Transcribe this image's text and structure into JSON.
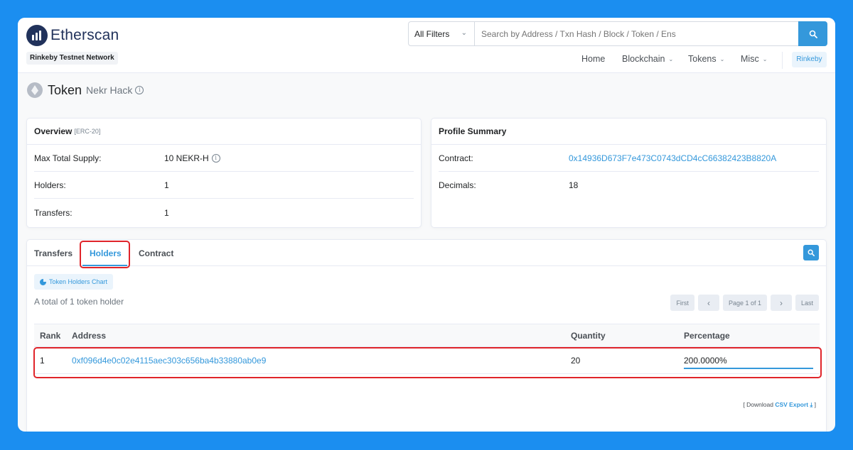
{
  "header": {
    "logo_text": "Etherscan",
    "network_badge": "Rinkeby Testnet Network",
    "search": {
      "filter_value": "All Filters",
      "placeholder": "Search by Address / Txn Hash / Block / Token / Ens"
    },
    "nav": {
      "home": "Home",
      "blockchain": "Blockchain",
      "tokens": "Tokens",
      "misc": "Misc",
      "network_pill": "Rinkeby"
    }
  },
  "title": {
    "main": "Token",
    "sub": "Nekr Hack"
  },
  "overview": {
    "heading": "Overview",
    "tag": "[ERC-20]",
    "rows": [
      {
        "key": "Max Total Supply:",
        "value": "10 NEKR-H"
      },
      {
        "key": "Holders:",
        "value": "1"
      },
      {
        "key": "Transfers:",
        "value": "1"
      }
    ]
  },
  "profile": {
    "heading": "Profile Summary",
    "rows": [
      {
        "key": "Contract:",
        "value": "0x14936D673F7e473C0743dCD4cC66382423B8820A"
      },
      {
        "key": "Decimals:",
        "value": "18"
      }
    ]
  },
  "tabs": [
    {
      "label": "Transfers"
    },
    {
      "label": "Holders"
    },
    {
      "label": "Contract"
    }
  ],
  "holders": {
    "chart_button": "Token Holders Chart",
    "total_text": "A total of 1 token holder",
    "pager": {
      "first": "First",
      "prev": "‹",
      "page": "Page 1 of 1",
      "next": "›",
      "last": "Last"
    },
    "columns": [
      "Rank",
      "Address",
      "Quantity",
      "Percentage"
    ],
    "rows": [
      {
        "rank": "1",
        "address": "0xf096d4e0c02e4115aec303c656ba4b33880ab0e9",
        "quantity": "20",
        "percentage": "200.0000%"
      }
    ],
    "download_prefix": "[ Download",
    "download_link": "CSV Export",
    "download_suffix": "]"
  },
  "colors": {
    "accent": "#3498db",
    "highlight": "#e0242a",
    "background": "#1b8ef0"
  }
}
